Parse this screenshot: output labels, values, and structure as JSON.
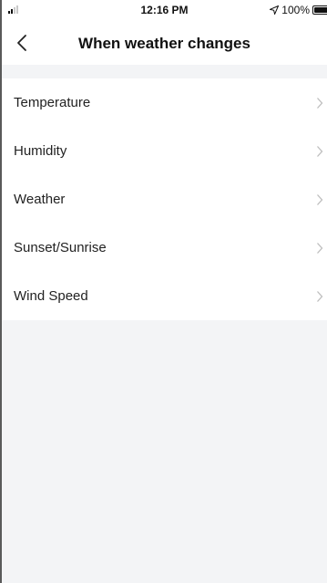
{
  "status_bar": {
    "time": "12:16 PM",
    "battery": "100%",
    "battery_level": 1.0,
    "signal_bars_active": 2,
    "signal_bars_total": 4
  },
  "nav": {
    "title": "When weather changes",
    "back_icon": "chevron-left-icon"
  },
  "list": {
    "items": [
      {
        "label": "Temperature",
        "icon": "chevron-right-icon"
      },
      {
        "label": "Humidity",
        "icon": "chevron-right-icon"
      },
      {
        "label": "Weather",
        "icon": "chevron-right-icon"
      },
      {
        "label": "Sunset/Sunrise",
        "icon": "chevron-right-icon"
      },
      {
        "label": "Wind Speed",
        "icon": "chevron-right-icon"
      }
    ]
  },
  "colors": {
    "background": "#f3f4f6",
    "surface": "#ffffff",
    "text": "#222222",
    "chevron": "#bdbdbd"
  }
}
